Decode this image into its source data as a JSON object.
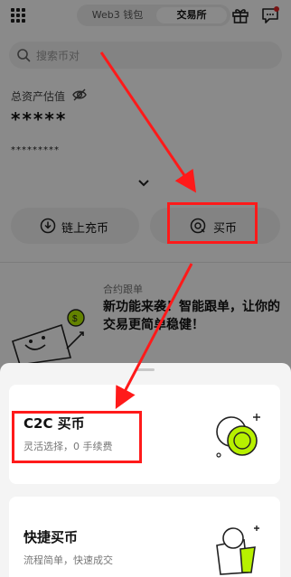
{
  "header": {
    "tabs": [
      {
        "label": "Web3 钱包",
        "active": false
      },
      {
        "label": "交易所",
        "active": true
      }
    ]
  },
  "search": {
    "placeholder": "搜索币对"
  },
  "assets": {
    "label": "总资产估值",
    "masked_value": "*****",
    "masked_sub": "*********"
  },
  "actions": [
    {
      "label": "链上充币"
    },
    {
      "label": "买币"
    }
  ],
  "promo": {
    "tag": "合约跟单",
    "text": "新功能来袭！智能跟单，让你的交易更简单稳健！"
  },
  "sheet": {
    "options": [
      {
        "title": "C2C 买币",
        "subtitle": "灵活选择，0 手续费"
      },
      {
        "title": "快捷买币",
        "subtitle": "流程简单，快速成交"
      }
    ]
  },
  "colors": {
    "accent_green": "#b7f000",
    "annotation_red": "#ff1a1a"
  },
  "icons": [
    "grid-icon",
    "gift-icon",
    "message-icon",
    "search-icon",
    "eye-off-icon",
    "chevron-down-icon",
    "download-icon",
    "buy-icon",
    "coins-icon",
    "wallet-icon"
  ]
}
